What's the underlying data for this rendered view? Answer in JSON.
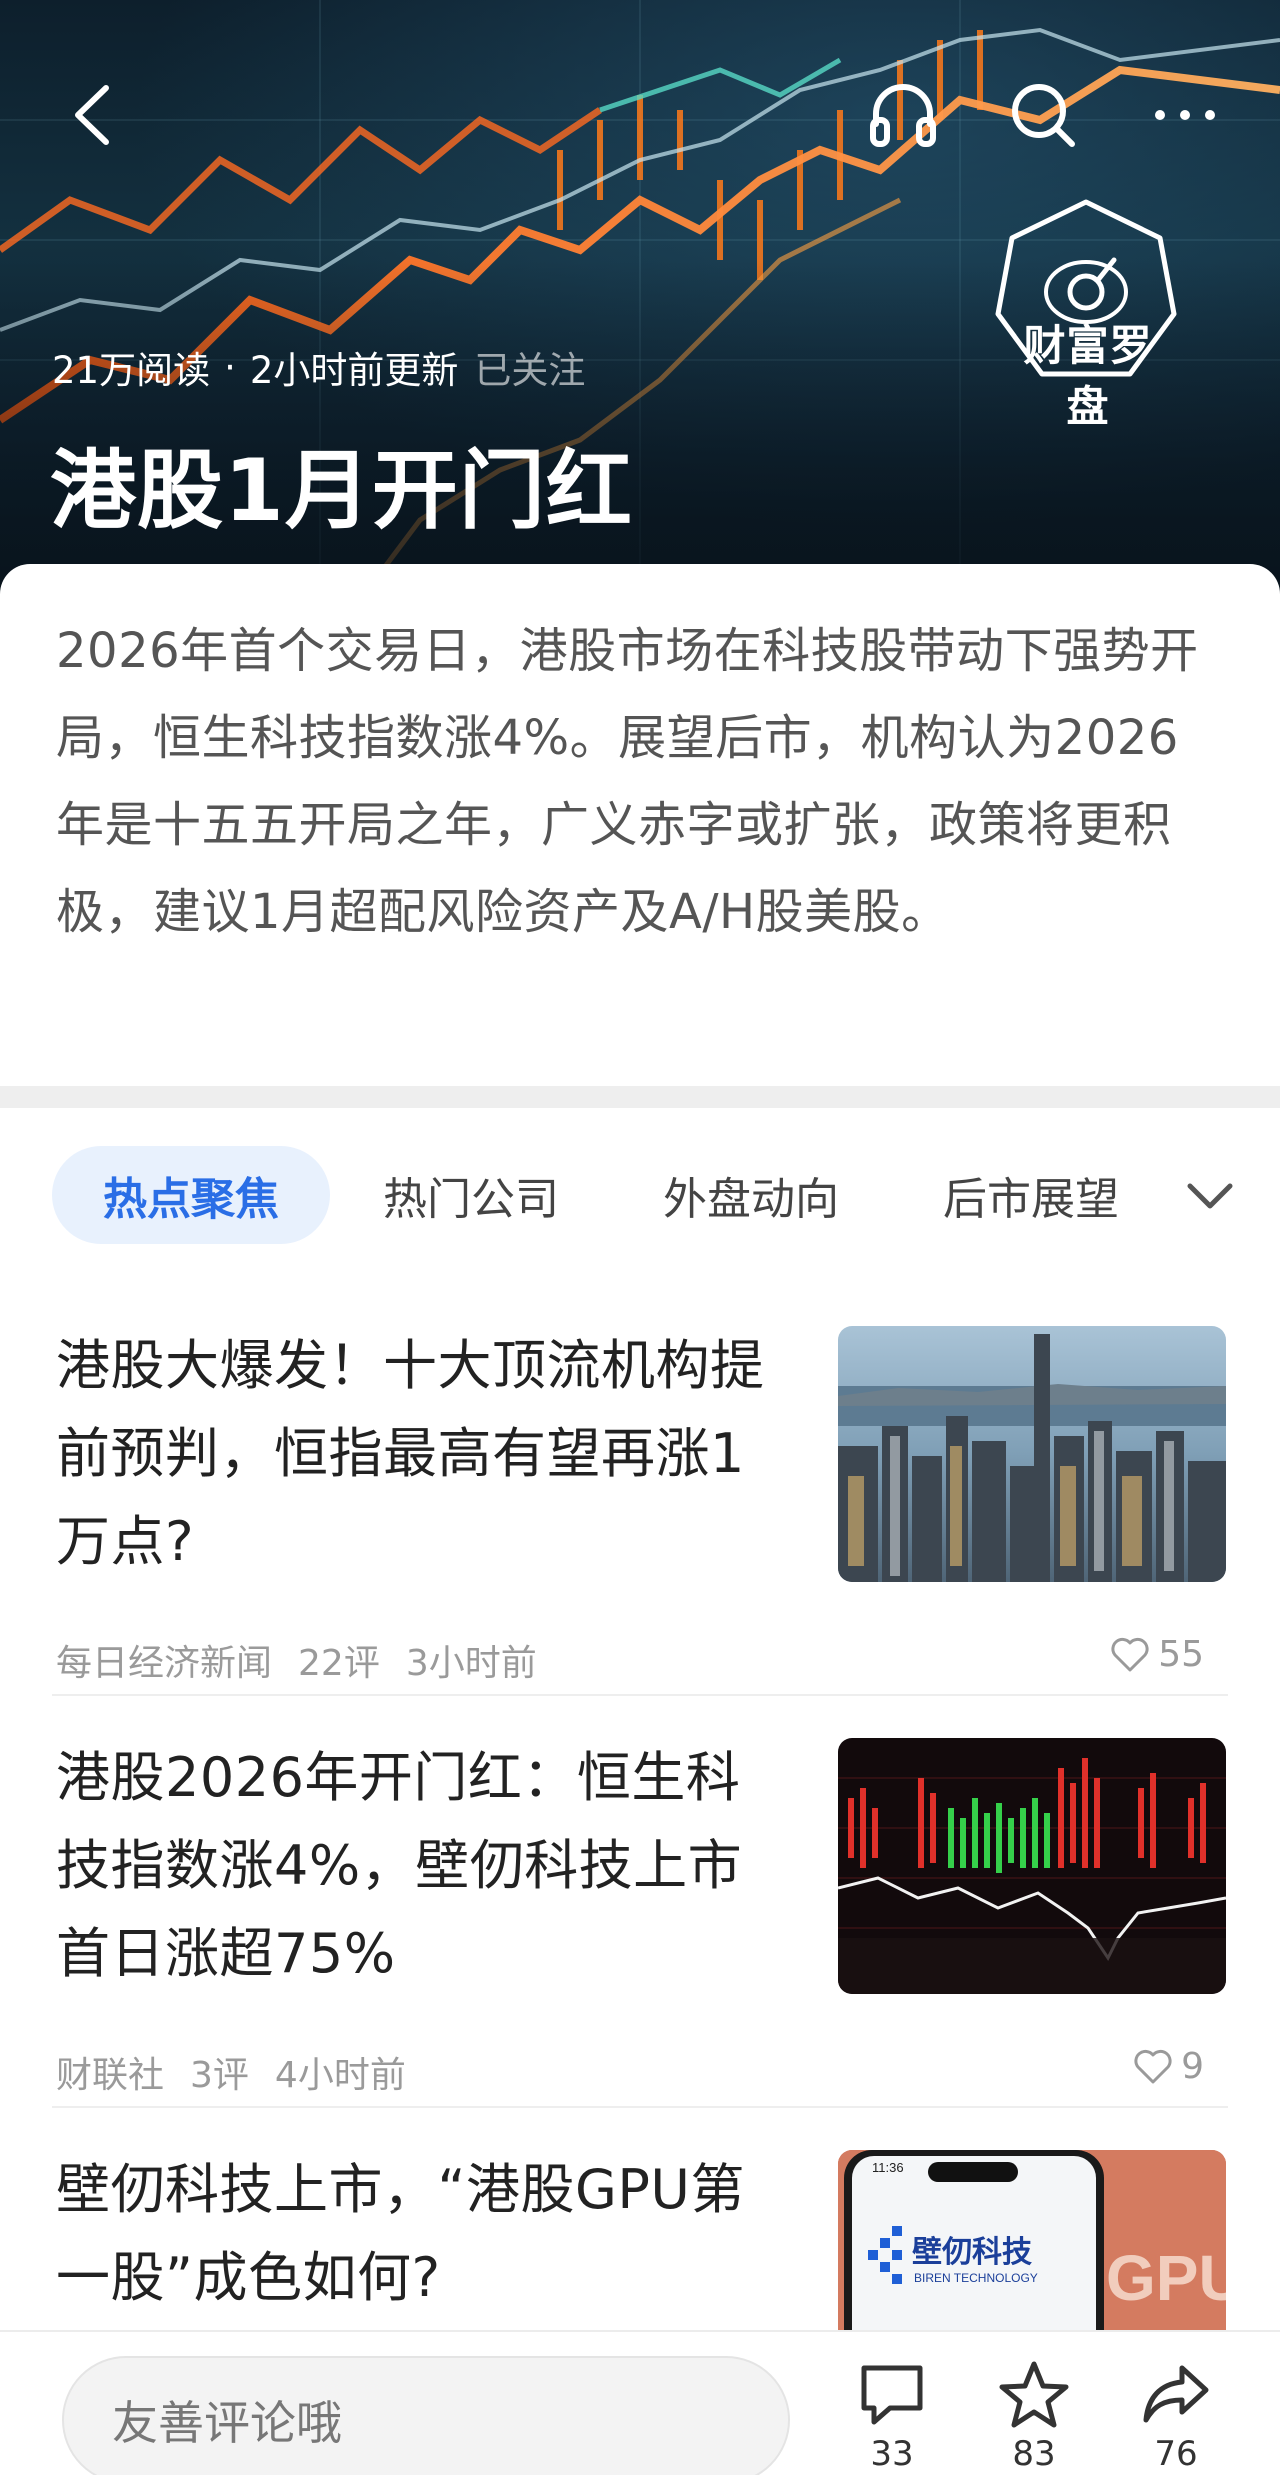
{
  "hero": {
    "reads": "21万阅读",
    "separator": "·",
    "updated": "2小时前更新",
    "follow_status": "已关注",
    "title": "港股1月开门红",
    "brand_name": "财富罗盘"
  },
  "summary": {
    "text": "2026年首个交易日，港股市场在科技股带动下强势开局，恒生科技指数涨4%。展望后市，机构认为2026年是十五五开局之年，广义赤字或扩张，政策将更积极，建议1月超配风险资产及A/H股美股。"
  },
  "tabs": [
    {
      "label": "热点聚焦",
      "active": true
    },
    {
      "label": "热门公司",
      "active": false
    },
    {
      "label": "外盘动向",
      "active": false
    },
    {
      "label": "后市展望",
      "active": false
    }
  ],
  "news": [
    {
      "title": "港股大爆发！十大顶流机构提前预判，恒指最高有望再涨1万点?",
      "source": "每日经济新闻",
      "comments": "22评",
      "time": "3小时前",
      "likes": "55",
      "thumb": "city-skyline"
    },
    {
      "title": "港股2026年开门红：恒生科技指数涨4%，壁仞科技上市首日涨超75%",
      "source": "财联社",
      "comments": "3评",
      "time": "4小时前",
      "likes": "9",
      "thumb": "stock-chart"
    },
    {
      "title": "壁仞科技上市，“港股GPU第一股”成色如何?",
      "thumb": "phone-gpu",
      "thumb_brand": "壁仞科技",
      "thumb_brand_en": "BIREN TECHNOLOGY",
      "thumb_time": "11:36",
      "thumb_text": "GPU"
    }
  ],
  "bottom_bar": {
    "comment_placeholder": "友善评论哦",
    "comment_count": "33",
    "favorite_count": "83",
    "share_count": "76"
  },
  "colors": {
    "accent": "#2a6ee6",
    "active_tab_bg": "#e8f1fd",
    "chart_orange": "#ff7a1a"
  }
}
